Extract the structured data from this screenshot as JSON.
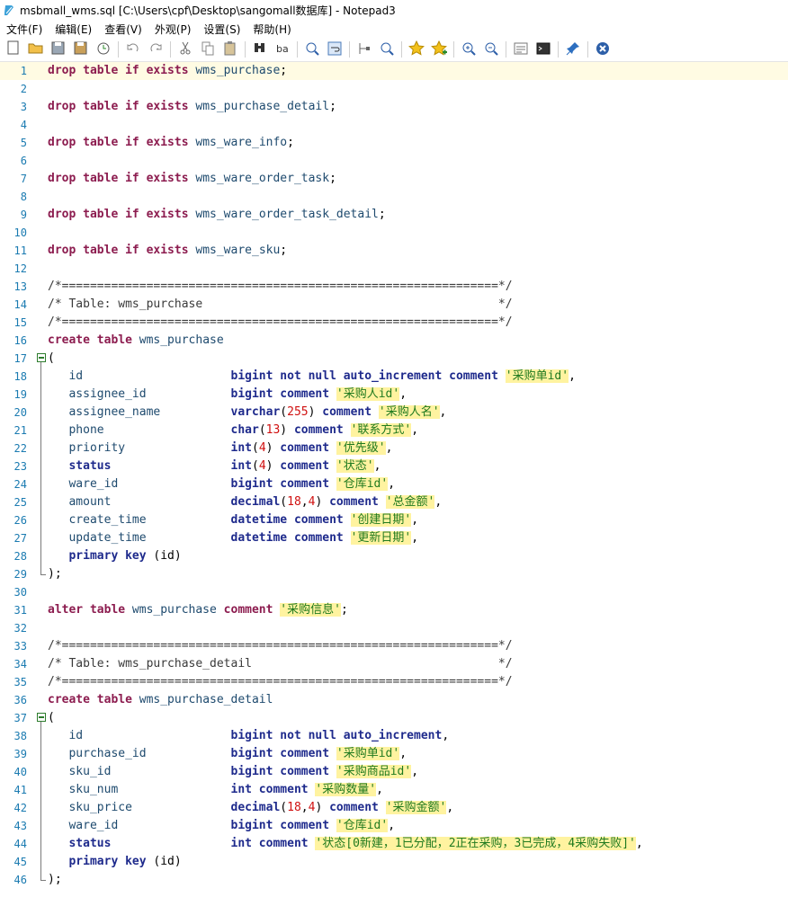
{
  "window": {
    "title": "msbmall_wms.sql [C:\\Users\\cpf\\Desktop\\sangomall数据库] - Notepad3"
  },
  "menu": [
    {
      "label": "文件(F)"
    },
    {
      "label": "编辑(E)"
    },
    {
      "label": "查看(V)"
    },
    {
      "label": "外观(P)"
    },
    {
      "label": "设置(S)"
    },
    {
      "label": "帮助(H)"
    }
  ],
  "toolbar": [
    {
      "icon": "new-file-icon"
    },
    {
      "icon": "open-folder-icon"
    },
    {
      "icon": "save-icon"
    },
    {
      "icon": "save-as-icon"
    },
    {
      "icon": "recent-files-icon"
    },
    {
      "icon": "undo-icon"
    },
    {
      "icon": "redo-icon"
    },
    {
      "icon": "cut-icon"
    },
    {
      "icon": "copy-icon"
    },
    {
      "icon": "paste-icon"
    },
    {
      "icon": "find-icon"
    },
    {
      "icon": "replace-icon"
    },
    {
      "icon": "zoom-find-icon"
    },
    {
      "icon": "word-wrap-icon"
    },
    {
      "icon": "goto-icon"
    },
    {
      "icon": "search-next-icon"
    },
    {
      "icon": "bookmark-icon"
    },
    {
      "icon": "add-bookmark-icon"
    },
    {
      "icon": "zoom-in-icon"
    },
    {
      "icon": "zoom-out-icon"
    },
    {
      "icon": "doc-info-icon"
    },
    {
      "icon": "console-icon"
    },
    {
      "icon": "pin-icon"
    },
    {
      "icon": "close-icon"
    }
  ],
  "editor": {
    "current_line": 1,
    "lines": [
      {
        "n": "1",
        "t": [
          [
            "kw",
            "drop table if exists"
          ],
          [
            "id",
            " wms_purchase"
          ],
          [
            "pn",
            ";"
          ]
        ]
      },
      {
        "n": "2",
        "t": []
      },
      {
        "n": "3",
        "t": [
          [
            "kw",
            "drop table if exists"
          ],
          [
            "id",
            " wms_purchase_detail"
          ],
          [
            "pn",
            ";"
          ]
        ]
      },
      {
        "n": "4",
        "t": []
      },
      {
        "n": "5",
        "t": [
          [
            "kw",
            "drop table if exists"
          ],
          [
            "id",
            " wms_ware_info"
          ],
          [
            "pn",
            ";"
          ]
        ]
      },
      {
        "n": "6",
        "t": []
      },
      {
        "n": "7",
        "t": [
          [
            "kw",
            "drop table if exists"
          ],
          [
            "id",
            " wms_ware_order_task"
          ],
          [
            "pn",
            ";"
          ]
        ]
      },
      {
        "n": "8",
        "t": []
      },
      {
        "n": "9",
        "t": [
          [
            "kw",
            "drop table if exists"
          ],
          [
            "id",
            " wms_ware_order_task_detail"
          ],
          [
            "pn",
            ";"
          ]
        ]
      },
      {
        "n": "10",
        "t": []
      },
      {
        "n": "11",
        "t": [
          [
            "kw",
            "drop table if exists"
          ],
          [
            "id",
            " wms_ware_sku"
          ],
          [
            "pn",
            ";"
          ]
        ]
      },
      {
        "n": "12",
        "t": []
      },
      {
        "n": "13",
        "t": [
          [
            "cmt",
            "/*==============================================================*/"
          ]
        ]
      },
      {
        "n": "14",
        "t": [
          [
            "cmt",
            "/* Table: wms_purchase                                          */"
          ]
        ]
      },
      {
        "n": "15",
        "t": [
          [
            "cmt",
            "/*==============================================================*/"
          ]
        ]
      },
      {
        "n": "16",
        "t": [
          [
            "kw",
            "create table"
          ],
          [
            "id",
            " wms_purchase"
          ]
        ]
      },
      {
        "n": "17",
        "fold": "start",
        "t": [
          [
            "pn",
            "("
          ]
        ]
      },
      {
        "n": "18",
        "fold": "mid",
        "t": [
          [
            "id",
            "   id                     "
          ],
          [
            "kw-b",
            "bigint not null auto_increment comment"
          ],
          [
            "pn",
            " "
          ],
          [
            "str",
            "'采购单id'"
          ],
          [
            "pn",
            ","
          ]
        ]
      },
      {
        "n": "19",
        "fold": "mid",
        "t": [
          [
            "id",
            "   assignee_id            "
          ],
          [
            "kw-b",
            "bigint comment"
          ],
          [
            "pn",
            " "
          ],
          [
            "str",
            "'采购人id'"
          ],
          [
            "pn",
            ","
          ]
        ]
      },
      {
        "n": "20",
        "fold": "mid",
        "t": [
          [
            "id",
            "   assignee_name          "
          ],
          [
            "kw-b",
            "varchar"
          ],
          [
            "pn",
            "("
          ],
          [
            "num",
            "255"
          ],
          [
            "pn",
            ") "
          ],
          [
            "kw-b",
            "comment"
          ],
          [
            "pn",
            " "
          ],
          [
            "str",
            "'采购人名'"
          ],
          [
            "pn",
            ","
          ]
        ]
      },
      {
        "n": "21",
        "fold": "mid",
        "t": [
          [
            "id",
            "   phone                  "
          ],
          [
            "kw-b",
            "char"
          ],
          [
            "pn",
            "("
          ],
          [
            "num",
            "13"
          ],
          [
            "pn",
            ") "
          ],
          [
            "kw-b",
            "comment"
          ],
          [
            "pn",
            " "
          ],
          [
            "str",
            "'联系方式'"
          ],
          [
            "pn",
            ","
          ]
        ]
      },
      {
        "n": "22",
        "fold": "mid",
        "t": [
          [
            "id",
            "   priority               "
          ],
          [
            "kw-b",
            "int"
          ],
          [
            "pn",
            "("
          ],
          [
            "num",
            "4"
          ],
          [
            "pn",
            ") "
          ],
          [
            "kw-b",
            "comment"
          ],
          [
            "pn",
            " "
          ],
          [
            "str",
            "'优先级'"
          ],
          [
            "pn",
            ","
          ]
        ]
      },
      {
        "n": "23",
        "fold": "mid",
        "t": [
          [
            "kw-b",
            "   status                 "
          ],
          [
            "kw-b",
            "int"
          ],
          [
            "pn",
            "("
          ],
          [
            "num",
            "4"
          ],
          [
            "pn",
            ") "
          ],
          [
            "kw-b",
            "comment"
          ],
          [
            "pn",
            " "
          ],
          [
            "str",
            "'状态'"
          ],
          [
            "pn",
            ","
          ]
        ]
      },
      {
        "n": "24",
        "fold": "mid",
        "t": [
          [
            "id",
            "   ware_id                "
          ],
          [
            "kw-b",
            "bigint comment"
          ],
          [
            "pn",
            " "
          ],
          [
            "str",
            "'仓库id'"
          ],
          [
            "pn",
            ","
          ]
        ]
      },
      {
        "n": "25",
        "fold": "mid",
        "t": [
          [
            "id",
            "   amount                 "
          ],
          [
            "kw-b",
            "decimal"
          ],
          [
            "pn",
            "("
          ],
          [
            "num",
            "18"
          ],
          [
            "pn",
            ","
          ],
          [
            "num",
            "4"
          ],
          [
            "pn",
            ") "
          ],
          [
            "kw-b",
            "comment"
          ],
          [
            "pn",
            " "
          ],
          [
            "str",
            "'总金额'"
          ],
          [
            "pn",
            ","
          ]
        ]
      },
      {
        "n": "26",
        "fold": "mid",
        "t": [
          [
            "id",
            "   create_time            "
          ],
          [
            "kw-b",
            "datetime comment"
          ],
          [
            "pn",
            " "
          ],
          [
            "str",
            "'创建日期'"
          ],
          [
            "pn",
            ","
          ]
        ]
      },
      {
        "n": "27",
        "fold": "mid",
        "t": [
          [
            "id",
            "   update_time            "
          ],
          [
            "kw-b",
            "datetime comment"
          ],
          [
            "pn",
            " "
          ],
          [
            "str",
            "'更新日期'"
          ],
          [
            "pn",
            ","
          ]
        ]
      },
      {
        "n": "28",
        "fold": "mid",
        "t": [
          [
            "kw-b",
            "   primary key"
          ],
          [
            "pn",
            " (id)"
          ]
        ]
      },
      {
        "n": "29",
        "fold": "end",
        "t": [
          [
            "pn",
            ");"
          ]
        ]
      },
      {
        "n": "30",
        "t": []
      },
      {
        "n": "31",
        "t": [
          [
            "kw",
            "alter table"
          ],
          [
            "id",
            " wms_purchase "
          ],
          [
            "kw",
            "comment"
          ],
          [
            "pn",
            " "
          ],
          [
            "str",
            "'采购信息'"
          ],
          [
            "pn",
            ";"
          ]
        ]
      },
      {
        "n": "32",
        "t": []
      },
      {
        "n": "33",
        "t": [
          [
            "cmt",
            "/*==============================================================*/"
          ]
        ]
      },
      {
        "n": "34",
        "t": [
          [
            "cmt",
            "/* Table: wms_purchase_detail                                   */"
          ]
        ]
      },
      {
        "n": "35",
        "t": [
          [
            "cmt",
            "/*==============================================================*/"
          ]
        ]
      },
      {
        "n": "36",
        "t": [
          [
            "kw",
            "create table"
          ],
          [
            "id",
            " wms_purchase_detail"
          ]
        ]
      },
      {
        "n": "37",
        "fold": "start",
        "t": [
          [
            "pn",
            "("
          ]
        ]
      },
      {
        "n": "38",
        "fold": "mid",
        "t": [
          [
            "id",
            "   id                     "
          ],
          [
            "kw-b",
            "bigint not null auto_increment"
          ],
          [
            "pn",
            ","
          ]
        ]
      },
      {
        "n": "39",
        "fold": "mid",
        "t": [
          [
            "id",
            "   purchase_id            "
          ],
          [
            "kw-b",
            "bigint comment"
          ],
          [
            "pn",
            " "
          ],
          [
            "str",
            "'采购单id'"
          ],
          [
            "pn",
            ","
          ]
        ]
      },
      {
        "n": "40",
        "fold": "mid",
        "t": [
          [
            "id",
            "   sku_id                 "
          ],
          [
            "kw-b",
            "bigint comment"
          ],
          [
            "pn",
            " "
          ],
          [
            "str",
            "'采购商品id'"
          ],
          [
            "pn",
            ","
          ]
        ]
      },
      {
        "n": "41",
        "fold": "mid",
        "t": [
          [
            "id",
            "   sku_num                "
          ],
          [
            "kw-b",
            "int comment"
          ],
          [
            "pn",
            " "
          ],
          [
            "str",
            "'采购数量'"
          ],
          [
            "pn",
            ","
          ]
        ]
      },
      {
        "n": "42",
        "fold": "mid",
        "t": [
          [
            "id",
            "   sku_price              "
          ],
          [
            "kw-b",
            "decimal"
          ],
          [
            "pn",
            "("
          ],
          [
            "num",
            "18"
          ],
          [
            "pn",
            ","
          ],
          [
            "num",
            "4"
          ],
          [
            "pn",
            ") "
          ],
          [
            "kw-b",
            "comment"
          ],
          [
            "pn",
            " "
          ],
          [
            "str",
            "'采购金额'"
          ],
          [
            "pn",
            ","
          ]
        ]
      },
      {
        "n": "43",
        "fold": "mid",
        "t": [
          [
            "id",
            "   ware_id                "
          ],
          [
            "kw-b",
            "bigint comment"
          ],
          [
            "pn",
            " "
          ],
          [
            "str",
            "'仓库id'"
          ],
          [
            "pn",
            ","
          ]
        ]
      },
      {
        "n": "44",
        "fold": "mid",
        "t": [
          [
            "kw-b",
            "   status                 "
          ],
          [
            "kw-b",
            "int comment"
          ],
          [
            "pn",
            " "
          ],
          [
            "str",
            "'状态[0新建，1已分配，2正在采购，3已完成，4采购失败]'"
          ],
          [
            "pn",
            ","
          ]
        ]
      },
      {
        "n": "45",
        "fold": "mid",
        "t": [
          [
            "kw-b",
            "   primary key"
          ],
          [
            "pn",
            " (id)"
          ]
        ]
      },
      {
        "n": "46",
        "fold": "end",
        "t": [
          [
            "pn",
            ");"
          ]
        ]
      }
    ]
  }
}
